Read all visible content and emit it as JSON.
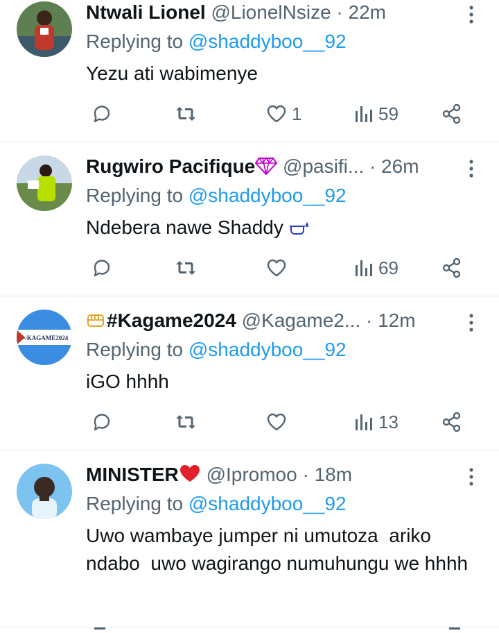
{
  "replies": [
    {
      "name": "Ntwali Lionel",
      "name_suffix": "",
      "name_prefix": "",
      "handle": "@LionelNsize",
      "time": "· 22m",
      "replying_label": "Replying to",
      "replying_to": "@shaddyboo__92",
      "text": "Yezu ati wabimenye",
      "text_emoji": "",
      "likes": "1",
      "views": "59",
      "avatar_colors": [
        "#6b8f5a",
        "#c0392b",
        "#2e4a2a"
      ]
    },
    {
      "name": "Rugwiro Pacifique",
      "name_suffix": "💎",
      "name_prefix": "",
      "handle": "@pasifi...",
      "time": "· 26m",
      "replying_label": "Replying to",
      "replying_to": "@shaddyboo__92",
      "text": "Ndebera nawe Shaddy",
      "text_emoji": "🛁",
      "likes": "",
      "views": "69",
      "avatar_colors": [
        "#a7c3e0",
        "#b7e000",
        "#3a5d2b"
      ]
    },
    {
      "name": "#Kagame2024",
      "name_suffix": "",
      "name_prefix": "👊",
      "handle": "@Kagame2...",
      "time": "· 12m",
      "replying_label": "Replying to",
      "replying_to": "@shaddyboo__92",
      "text": "iGO hhhh",
      "text_emoji": "",
      "likes": "",
      "views": "13",
      "avatar_text": "=KAGAME2024",
      "avatar_colors": [
        "#3a8de0",
        "#ffffff",
        "#1b2b5a"
      ]
    },
    {
      "name": "MINISTER",
      "name_suffix": "❤️",
      "name_prefix": "",
      "handle": "@Ipromoo",
      "time": "· 18m",
      "replying_label": "Replying to",
      "replying_to": "@shaddyboo__92",
      "text": "Uwo wambaye jumper ni umutoza  ariko ndabo  uwo wagirango numuhungu we hhhh",
      "text_emoji": "",
      "likes": "",
      "views": "",
      "avatar_colors": [
        "#7cc4ef",
        "#3b2a22",
        "#e8f4fb"
      ]
    }
  ],
  "icons": {
    "reply": "reply-icon",
    "retweet": "retweet-icon",
    "like": "heart-icon",
    "views": "views-icon",
    "share": "share-icon",
    "more": "more-icon"
  },
  "colors": {
    "text": "#0f1419",
    "secondary": "#536471",
    "link": "#1d9bf0",
    "divider": "#e6ecf0"
  }
}
